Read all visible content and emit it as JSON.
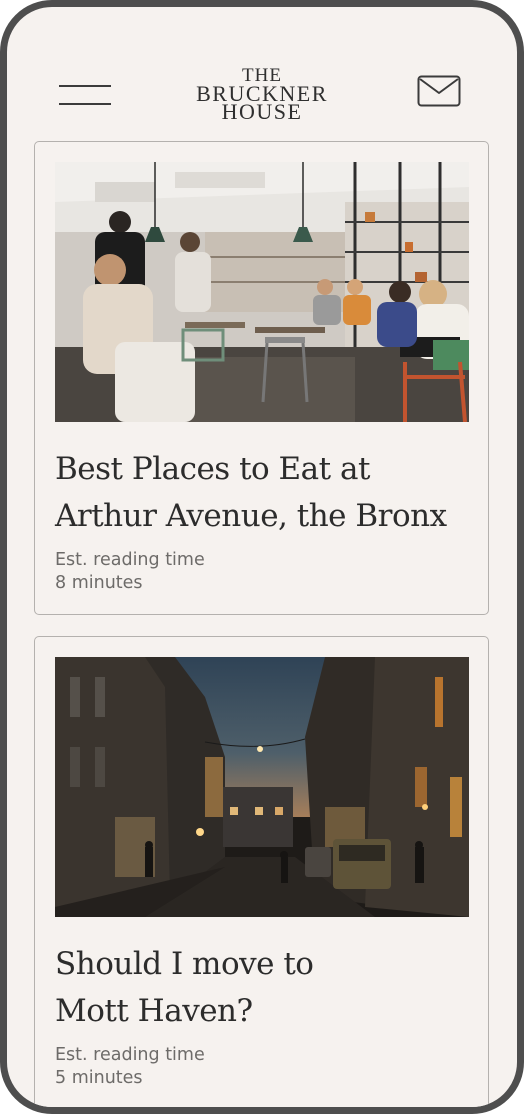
{
  "brand": {
    "line1": "THE",
    "line2": "BRUCKNER",
    "line3": "HOUSE"
  },
  "header": {
    "menu_icon": "hamburger-menu-icon",
    "mail_icon": "envelope-icon"
  },
  "articles": [
    {
      "title_line1": "Best Places to Eat at",
      "title_line2": "Arthur Avenue, the Bronx",
      "meta_label": "Est. reading time",
      "meta_value": "8 minutes",
      "image": "restaurant-interior-photo"
    },
    {
      "title_line1": "Should I move to",
      "title_line2": "Mott Haven?",
      "meta_label": "Est. reading time",
      "meta_value": "5 minutes",
      "image": "evening-street-photo"
    }
  ],
  "colors": {
    "background": "#f6f2ef",
    "frame": "#4e4e4e",
    "text": "#2c2c2c",
    "muted_text": "#6d6b69",
    "card_border": "#b4b1ae"
  }
}
